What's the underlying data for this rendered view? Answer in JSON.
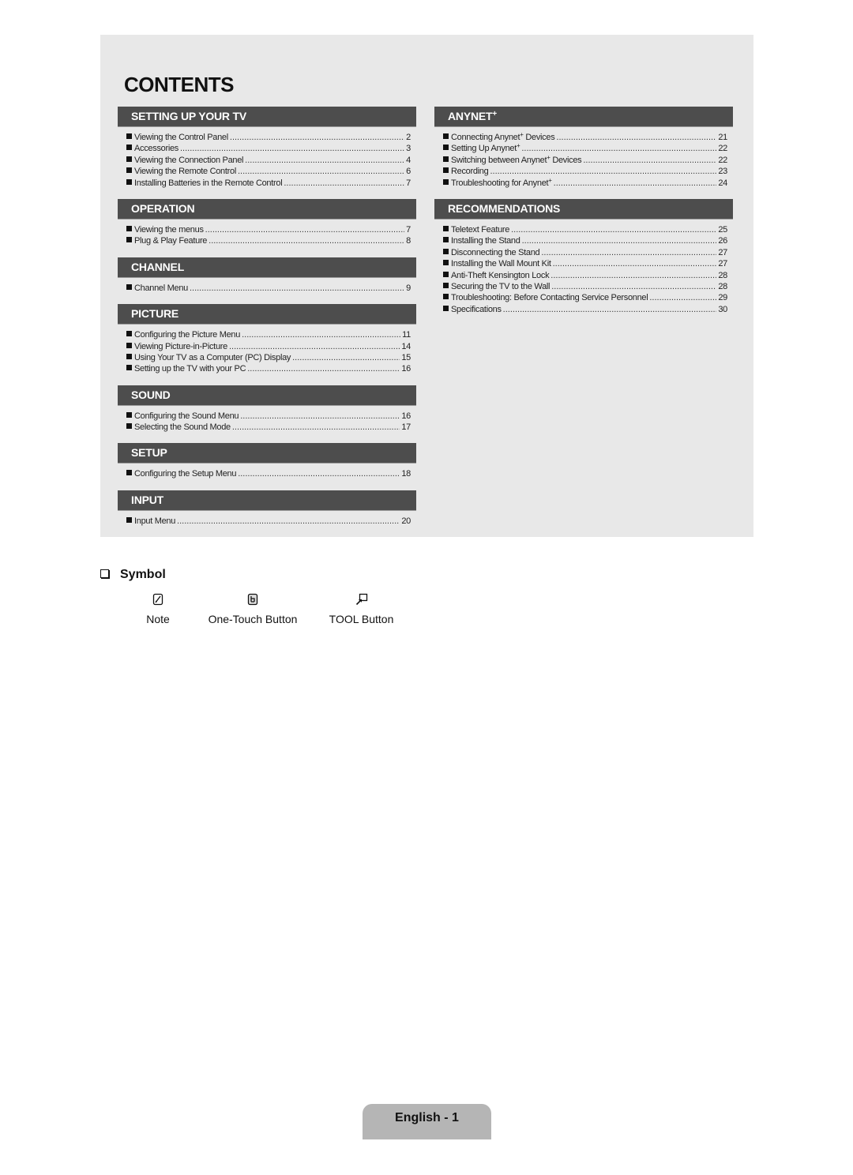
{
  "title": "CONTENTS",
  "left_sections": [
    {
      "header": "SETTING UP YOUR TV",
      "items": [
        {
          "label": "Viewing the Control Panel",
          "page": "2"
        },
        {
          "label": "Accessories",
          "page": "3"
        },
        {
          "label": "Viewing the Connection Panel",
          "page": "4"
        },
        {
          "label": "Viewing the Remote Control",
          "page": "6"
        },
        {
          "label": "Installing Batteries in the Remote Control",
          "page": "7"
        }
      ]
    },
    {
      "header": "OPERATION",
      "items": [
        {
          "label": "Viewing the menus",
          "page": "7"
        },
        {
          "label": "Plug & Play Feature",
          "page": "8"
        }
      ]
    },
    {
      "header": "CHANNEL",
      "items": [
        {
          "label": "Channel Menu",
          "page": "9"
        }
      ]
    },
    {
      "header": "PICTURE",
      "items": [
        {
          "label": "Configuring the Picture Menu",
          "page": "11"
        },
        {
          "label": "Viewing Picture-in-Picture",
          "page": "14"
        },
        {
          "label": "Using Your TV as a Computer (PC) Display",
          "page": "15"
        },
        {
          "label": "Setting up the TV with your PC",
          "page": "16"
        }
      ]
    },
    {
      "header": "SOUND",
      "items": [
        {
          "label": "Configuring the Sound Menu",
          "page": "16"
        },
        {
          "label": "Selecting the Sound Mode",
          "page": "17"
        }
      ]
    },
    {
      "header": "SETUP",
      "items": [
        {
          "label": "Configuring the Setup Menu",
          "page": "18"
        }
      ]
    },
    {
      "header": "INPUT",
      "items": [
        {
          "label": "Input Menu",
          "page": "20"
        }
      ]
    }
  ],
  "right_sections": [
    {
      "header": "ANYNET+",
      "items": [
        {
          "label": "Connecting Anynet+ Devices",
          "page": "21"
        },
        {
          "label": "Setting Up Anynet+",
          "page": "22"
        },
        {
          "label": "Switching between Anynet+ Devices",
          "page": "22"
        },
        {
          "label": "Recording",
          "page": "23"
        },
        {
          "label": "Troubleshooting for Anynet+",
          "page": "24"
        }
      ]
    },
    {
      "header": "RECOMMENDATIONS",
      "items": [
        {
          "label": "Teletext Feature",
          "page": "25"
        },
        {
          "label": "Installing the Stand",
          "page": "26"
        },
        {
          "label": "Disconnecting the Stand",
          "page": "27"
        },
        {
          "label": "Installing the Wall Mount Kit",
          "page": "27"
        },
        {
          "label": "Anti-Theft Kensington Lock",
          "page": "28"
        },
        {
          "label": "Securing the TV to the Wall",
          "page": "28"
        },
        {
          "label": "Troubleshooting: Before Contacting Service Personnel",
          "page": "29"
        },
        {
          "label": "Specifications",
          "page": "30"
        }
      ]
    }
  ],
  "symbol": {
    "heading": "Symbol",
    "items": [
      {
        "icon": "note-icon",
        "label": "Note"
      },
      {
        "icon": "one-touch-icon",
        "label": "One-Touch Button"
      },
      {
        "icon": "tool-icon",
        "label": "TOOL Button"
      }
    ]
  },
  "footer": {
    "page_label": "English - 1"
  }
}
